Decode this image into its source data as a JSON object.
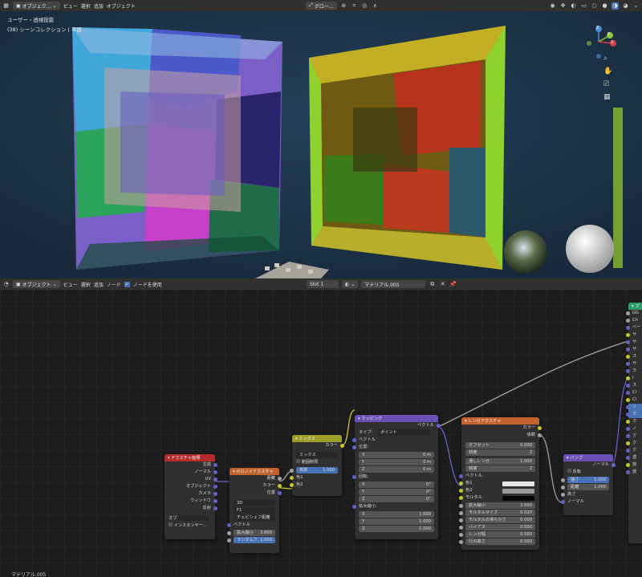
{
  "top_bar": {
    "mode": "オブジェク…",
    "menus": [
      "ビュー",
      "選択",
      "追加",
      "オブジェクト"
    ],
    "transform_orientation": "グロー…"
  },
  "viewport": {
    "view_title": "ユーザー・透視投影",
    "collection": "(38) シーンコレクション | 平面",
    "gizmo": {
      "z": "Z",
      "y": "Y",
      "x": "X"
    }
  },
  "node_header": {
    "mode": "オブジェクト",
    "menus": [
      "ビュー",
      "選択",
      "追加",
      "ノード"
    ],
    "use_nodes_label": "ノードを使用",
    "slot": "Slot 1",
    "material": "マテリアル.005"
  },
  "nodes": {
    "texcoord": {
      "title": "テクスチャ座標",
      "outputs": [
        "生成",
        "ノーマル",
        "UV",
        "オブジェクト",
        "カメラ",
        "ウィンドウ",
        "反射"
      ],
      "object_label": "オブ",
      "instancer": "インスタンサー…"
    },
    "voronoi": {
      "title": "ボロノイテクスチャ",
      "outputs": [
        "距離",
        "カラー",
        "位置"
      ],
      "dim": "3D",
      "feature": "F1",
      "metric": "チェビシェフ距離",
      "vector": "ベクトル",
      "scale_label": "拡大縮小",
      "scale_value": "3.800",
      "random_label": "ランダムさ",
      "random_value": "1.000"
    },
    "mix": {
      "title": "ミックス",
      "output": "カラー",
      "blend": "ミックス",
      "clamp": "範囲制限",
      "fac_label": "係数",
      "fac_value": "1.000",
      "color1": "色1",
      "color2": "色2"
    },
    "mapping": {
      "title": "マッピング",
      "output": "ベクトル",
      "type_label": "タイプ:",
      "type_value": "ポイント",
      "vector": "ベクトル",
      "location": "位置:",
      "loc": [
        [
          "X",
          "0 m"
        ],
        [
          "Y",
          "0 m"
        ],
        [
          "Z",
          "0 m"
        ]
      ],
      "rotation": "回転:",
      "rot": [
        [
          "X",
          "0°"
        ],
        [
          "Y",
          "0°"
        ],
        [
          "Z",
          "0°"
        ]
      ],
      "scale": "拡大縮小:",
      "scl": [
        [
          "X",
          "1.000"
        ],
        [
          "Y",
          "1.000"
        ],
        [
          "Z",
          "1.000"
        ]
      ]
    },
    "brick": {
      "title": "レンガテクスチャ",
      "outputs": [
        "カラー",
        "係数"
      ],
      "offset_label": "オフセット",
      "offset_value": "0.000",
      "freq1_label": "頻度",
      "freq1_value": "2",
      "squash_label": "潰しレンガ",
      "squash_value": "1.000",
      "freq2_label": "頻度",
      "freq2_value": "2",
      "vector": "ベクトル",
      "color1": "色1",
      "color2": "色2",
      "mortar": "モルタル",
      "fields": [
        [
          "拡大縮小",
          "3.000"
        ],
        [
          "モルタルサイズ",
          "0.020"
        ],
        [
          "モルタルの滑らかさ",
          "0.000"
        ],
        [
          "バイアス",
          "0.000"
        ],
        [
          "レンガ幅",
          "0.500"
        ],
        [
          "行の高さ",
          "0.500"
        ]
      ]
    },
    "bump": {
      "title": "バンプ",
      "output": "ノーマル",
      "invert": "反転",
      "strength_label": "強さ",
      "strength_value": "1.000",
      "distance_label": "距離",
      "distance_value": "1.000",
      "height": "高さ",
      "normal": "ノーマル"
    },
    "bsdf": {
      "title": "プ",
      "rows": [
        "GG",
        "Ch",
        "ベー",
        "サ",
        "サ",
        "サ",
        "ス",
        "サ",
        "ラ",
        "I",
        "ス",
        "Cl",
        "Cl",
        "ノ",
        "ク",
        "ク",
        "ノ",
        "ク",
        "ク",
        "ク",
        "透",
        "放",
        "放"
      ]
    }
  },
  "colors": {
    "mix_header": "#9d9d2a",
    "mapping_header": "#6a4fb5",
    "texcoord_header": "#b52a2a",
    "voronoi_header": "#c4622d",
    "brick_header": "#c4622d",
    "bump_header": "#6a4fb5",
    "bsdf_header": "#2a9d6b",
    "selected": "#4772b3"
  },
  "bottom_text": "マテリアル.005"
}
